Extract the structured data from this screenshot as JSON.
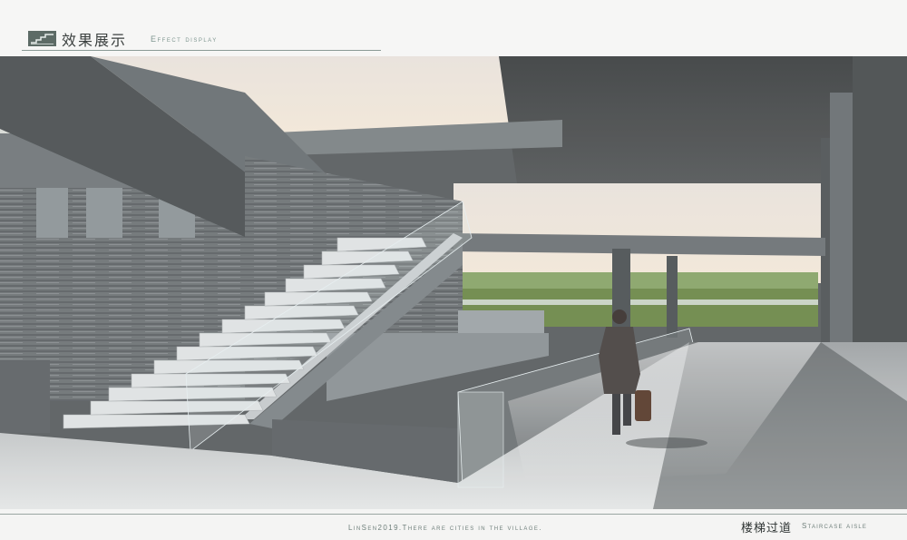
{
  "header": {
    "logo_icon": "staircase-logo-icon",
    "title_cn": "效果展示",
    "title_en": "Effect display"
  },
  "render": {
    "description_icon": "architectural-render-image"
  },
  "footer": {
    "caption_left": "LinSen2019.There are cities in the village.",
    "caption_cn": "楼梯过道",
    "caption_en": "Staircase aisle"
  },
  "colors": {
    "accent": "#7f9690",
    "logo_bg": "#5d6b66",
    "rule": "#8a9a96"
  }
}
